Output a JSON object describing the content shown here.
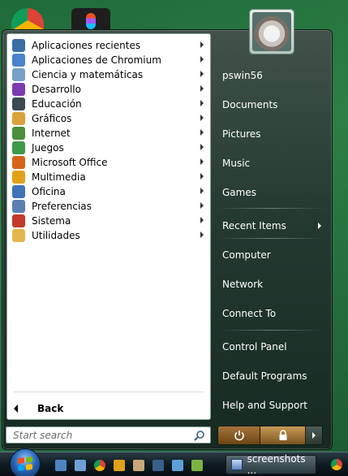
{
  "programs": [
    {
      "label": "Aplicaciones recientes",
      "icon": "clock-icon",
      "color": "#3a6ea5"
    },
    {
      "label": "Aplicaciones de Chromium",
      "icon": "chromium-icon",
      "color": "#4a82c9"
    },
    {
      "label": "Ciencia y matemáticas",
      "icon": "science-icon",
      "color": "#7aa0c8"
    },
    {
      "label": "Desarrollo",
      "icon": "visual-studio-icon",
      "color": "#7c3bb0"
    },
    {
      "label": "Educación",
      "icon": "monitor-icon",
      "color": "#3c4a52"
    },
    {
      "label": "Gráficos",
      "icon": "paint-icon",
      "color": "#d9a23a"
    },
    {
      "label": "Internet",
      "icon": "globe-icon",
      "color": "#4c8f3c"
    },
    {
      "label": "Juegos",
      "icon": "trophy-icon",
      "color": "#3d9a48"
    },
    {
      "label": "Microsoft Office",
      "icon": "office-icon",
      "color": "#d7641b"
    },
    {
      "label": "Multimedia",
      "icon": "media-player-icon",
      "color": "#e0a21a"
    },
    {
      "label": "Oficina",
      "icon": "document-icon",
      "color": "#3f73b7"
    },
    {
      "label": "Preferencias",
      "icon": "settings-list-icon",
      "color": "#5a7fb0"
    },
    {
      "label": "Sistema",
      "icon": "system-icon",
      "color": "#c23a2b"
    },
    {
      "label": "Utilidades",
      "icon": "folder-icon",
      "color": "#e2b84a"
    }
  ],
  "back_label": "Back",
  "search": {
    "placeholder": "Start search"
  },
  "user": {
    "name": "pswin56"
  },
  "places": [
    "Documents",
    "Pictures",
    "Music",
    "Games"
  ],
  "recent_items_label": "Recent Items",
  "system_places": [
    "Computer",
    "Network",
    "Connect To"
  ],
  "control_places": [
    "Control Panel",
    "Default Programs",
    "Help and Support"
  ],
  "taskbar": {
    "task_label": "screenshots ..."
  }
}
